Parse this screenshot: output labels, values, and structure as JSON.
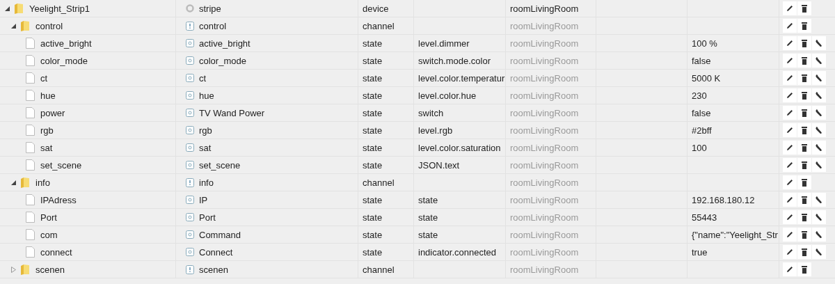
{
  "tree": [
    {
      "name": "Yeelight_Strip1",
      "kind": "device",
      "expanded": true,
      "common_name": "stripe",
      "type": "device",
      "room": "roomLivingRoom",
      "room_inherited": false,
      "settings": false,
      "children": [
        {
          "name": "control",
          "kind": "channel",
          "expanded": true,
          "common_name": "control",
          "type": "channel",
          "room": "roomLivingRoom",
          "room_inherited": true,
          "settings": false,
          "children": [
            {
              "name": "active_bright",
              "kind": "state",
              "common_name": "active_bright",
              "type": "state",
              "role": "level.dimmer",
              "room": "roomLivingRoom",
              "room_inherited": true,
              "value": "100 %",
              "settings": true
            },
            {
              "name": "color_mode",
              "kind": "state",
              "common_name": "color_mode",
              "type": "state",
              "role": "switch.mode.color",
              "room": "roomLivingRoom",
              "room_inherited": true,
              "value": "false",
              "settings": true
            },
            {
              "name": "ct",
              "kind": "state",
              "common_name": "ct",
              "type": "state",
              "role": "level.color.temperatur",
              "room": "roomLivingRoom",
              "room_inherited": true,
              "value": "5000 K",
              "settings": true
            },
            {
              "name": "hue",
              "kind": "state",
              "common_name": "hue",
              "type": "state",
              "role": "level.color.hue",
              "room": "roomLivingRoom",
              "room_inherited": true,
              "value": "230",
              "settings": true
            },
            {
              "name": "power",
              "kind": "state",
              "common_name": "TV Wand Power",
              "type": "state",
              "role": "switch",
              "room": "roomLivingRoom",
              "room_inherited": true,
              "value": "false",
              "settings": true
            },
            {
              "name": "rgb",
              "kind": "state",
              "common_name": "rgb",
              "type": "state",
              "role": "level.rgb",
              "room": "roomLivingRoom",
              "room_inherited": true,
              "value": "#2bff",
              "settings": true
            },
            {
              "name": "sat",
              "kind": "state",
              "common_name": "sat",
              "type": "state",
              "role": "level.color.saturation",
              "room": "roomLivingRoom",
              "room_inherited": true,
              "value": "100",
              "settings": true
            },
            {
              "name": "set_scene",
              "kind": "state",
              "common_name": "set_scene",
              "type": "state",
              "role": "JSON.text",
              "room": "roomLivingRoom",
              "room_inherited": true,
              "settings": true
            }
          ]
        },
        {
          "name": "info",
          "kind": "channel",
          "expanded": true,
          "common_name": "info",
          "type": "channel",
          "room": "roomLivingRoom",
          "room_inherited": true,
          "settings": false,
          "children": [
            {
              "name": "IPAdress",
              "kind": "state",
              "common_name": "IP",
              "type": "state",
              "role": "state",
              "room": "roomLivingRoom",
              "room_inherited": true,
              "value": "192.168.180.12",
              "settings": true
            },
            {
              "name": "Port",
              "kind": "state",
              "common_name": "Port",
              "type": "state",
              "role": "state",
              "room": "roomLivingRoom",
              "room_inherited": true,
              "value": "55443",
              "settings": true
            },
            {
              "name": "com",
              "kind": "state",
              "common_name": "Command",
              "type": "state",
              "role": "state",
              "room": "roomLivingRoom",
              "room_inherited": true,
              "value": "{\"name\":\"Yeelight_Str",
              "settings": true
            },
            {
              "name": "connect",
              "kind": "state",
              "common_name": "Connect",
              "type": "state",
              "role": "indicator.connected",
              "room": "roomLivingRoom",
              "room_inherited": true,
              "value": "true",
              "settings": true
            }
          ]
        },
        {
          "name": "scenen",
          "kind": "channel",
          "expanded": false,
          "common_name": "scenen",
          "type": "channel",
          "room": "roomLivingRoom",
          "room_inherited": true,
          "settings": false
        }
      ]
    }
  ]
}
